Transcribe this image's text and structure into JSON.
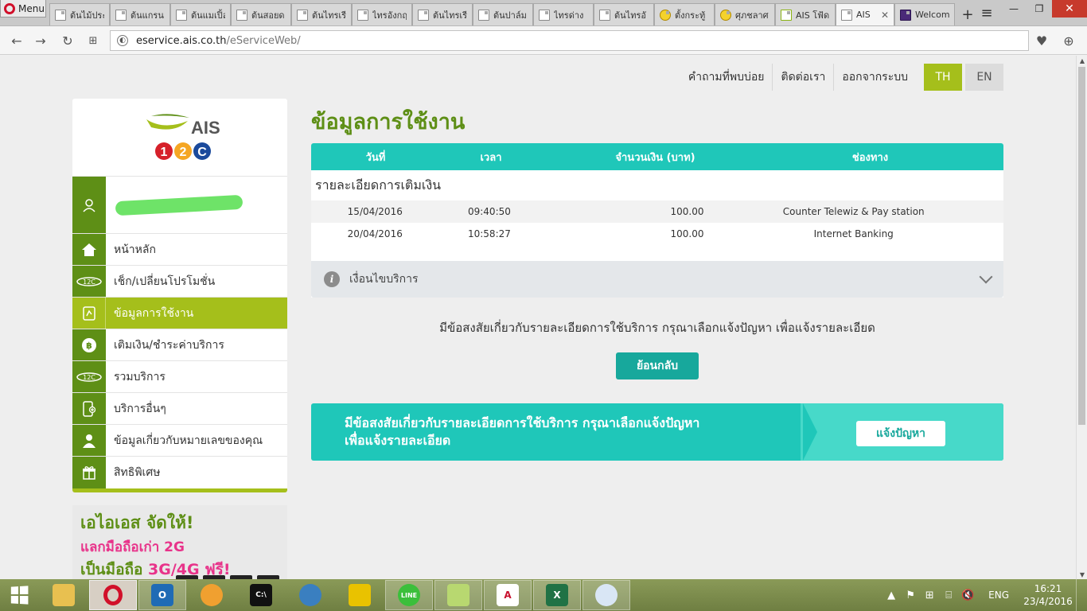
{
  "browser": {
    "menu_label": "Menu",
    "tabs": [
      {
        "label": "ต้นไม้ประ",
        "icon": "page-icon"
      },
      {
        "label": "ต้นแกรน",
        "icon": "page-icon"
      },
      {
        "label": "ต้นแมเปิ้ล",
        "icon": "page-icon"
      },
      {
        "label": "ต้นสอยด",
        "icon": "page-icon"
      },
      {
        "label": "ต้นไทรเรี",
        "icon": "page-icon"
      },
      {
        "label": "ไทรอังกฤ",
        "icon": "page-icon"
      },
      {
        "label": "ต้นไทรเรี",
        "icon": "page-icon"
      },
      {
        "label": "ต้นปาล์ม",
        "icon": "page-icon"
      },
      {
        "label": "ไทรด่าง",
        "icon": "page-icon"
      },
      {
        "label": "ต้นไทรอั",
        "icon": "page-icon"
      },
      {
        "label": "ตั้งกระทู้",
        "icon": "smiley-icon"
      },
      {
        "label": "ศุภชลาศ",
        "icon": "smiley-icon"
      },
      {
        "label": "AIS โฟ้ด",
        "icon": "ais-icon"
      },
      {
        "label": "AIS",
        "icon": "page-icon",
        "active": true
      },
      {
        "label": "Welcom",
        "icon": "scb-icon"
      }
    ],
    "new_tab": "+",
    "url_domain": "eservice.ais.co.th",
    "url_path": "/eServiceWeb/"
  },
  "topnav": {
    "faq": "คำถามที่พบบ่อย",
    "contact": "ติดต่อเรา",
    "logout": "ออกจากระบบ",
    "lang_th": "TH",
    "lang_en": "EN"
  },
  "logo": {
    "brand": "AIS",
    "sub1": "1",
    "sub2": "2",
    "sub3": "C"
  },
  "sidebar": {
    "items": [
      {
        "label": "หน้าหลัก",
        "icon": "home-icon"
      },
      {
        "label": "เช็ก/เปลี่ยนโปรโมชั่น",
        "icon": "promotion-icon"
      },
      {
        "label": "ข้อมูลการใช้งาน",
        "icon": "usage-icon",
        "active": true
      },
      {
        "label": "เติมเงิน/ชำระค่าบริการ",
        "icon": "baht-coin-icon"
      },
      {
        "label": "รวมบริการ",
        "icon": "services-icon"
      },
      {
        "label": "บริการอื่นๆ",
        "icon": "other-services-icon"
      },
      {
        "label": "ข้อมูลเกี่ยวกับหมายเลขของคุณ",
        "icon": "person-icon"
      },
      {
        "label": "สิทธิพิเศษ",
        "icon": "gift-icon"
      }
    ]
  },
  "promo": {
    "line1": "เอไอเอส จัดให้!",
    "line2": "แลกมือถือเก่า 2G",
    "line3a": "เป็นมือถือ ",
    "line3b": "3G/4G ฟรี!"
  },
  "main": {
    "title": "ข้อมูลการใช้งาน",
    "columns": [
      "วันที่",
      "เวลา",
      "จำนวนเงิน (บาท)",
      "ช่องทาง"
    ],
    "section_title": "รายละเอียดการเติมเงิน",
    "rows": [
      {
        "date": "15/04/2016",
        "time": "09:40:50",
        "amount": "100.00",
        "channel": "Counter Telewiz & Pay station"
      },
      {
        "date": "20/04/2016",
        "time": "10:58:27",
        "amount": "100.00",
        "channel": "Internet Banking"
      }
    ],
    "conditions_label": "เงื่อนไขบริการ",
    "question_text": "มีข้อสงสัยเกี่ยวกับรายละเอียดการใช้บริการ กรุณาเลือกแจ้งปัญหา เพื่อแจ้งรายละเอียด",
    "back_button": "ย้อนกลับ",
    "banner_line1": "มีข้อสงสัยเกี่ยวกับรายละเอียดการใช้บริการ กรุณาเลือกแจ้งปัญหา",
    "banner_line2": "เพื่อแจ้งรายละเอียด",
    "banner_button": "แจ้งปัญหา"
  },
  "taskbar": {
    "apps": [
      "file-explorer-icon",
      "opera-icon",
      "outlook-icon",
      "browser-icon",
      "cmd-icon",
      "messenger-icon",
      "app-icon",
      "line-icon",
      "folder-icon",
      "pdf-icon",
      "excel-icon",
      "paint-icon"
    ],
    "lang": "ENG",
    "time": "16:21",
    "date": "23/4/2016"
  },
  "colors": {
    "ais_green": "#a5bf1b",
    "ais_dark_green": "#5e8f16",
    "teal": "#1fc7b9",
    "teal_button": "#17a89c"
  }
}
